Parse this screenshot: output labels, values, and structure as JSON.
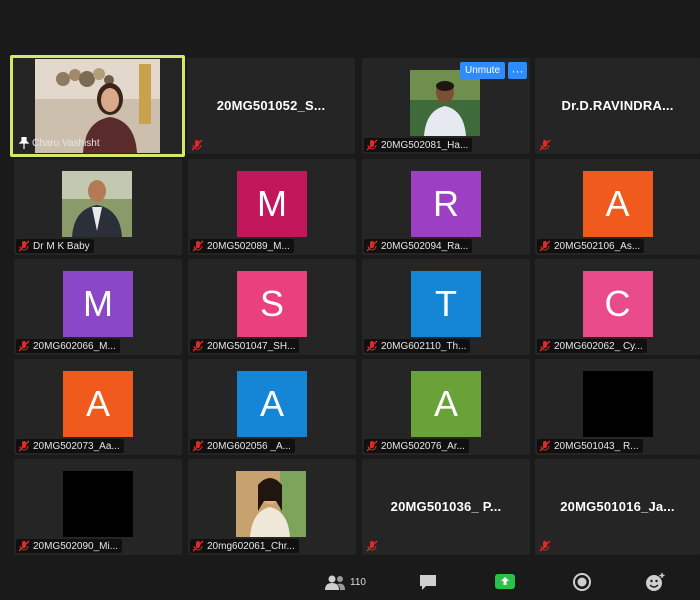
{
  "meeting": {
    "speaker": "Charu Vashisht",
    "participant_count": "110"
  },
  "controls": {
    "unmute_label": "Unmute",
    "more_label": "···"
  },
  "colors": {
    "speaker_border": "#d6e86a",
    "tile_bg": "#252525",
    "accent_blue": "#2d8cff",
    "mute_red": "#e02828",
    "share_green": "#27c24c"
  },
  "tiles": [
    {
      "label": "Charu Vashisht",
      "kind": "video",
      "speaker": true
    },
    {
      "label": "20MG501052_S...",
      "kind": "name"
    },
    {
      "label": "20MG502081_Ha...",
      "kind": "video"
    },
    {
      "label": "Dr.D.RAVINDRA...",
      "kind": "name"
    },
    {
      "label": "Dr M K Baby",
      "kind": "video"
    },
    {
      "label": "20MG502089_M...",
      "kind": "letter",
      "letter": "M",
      "color": "#c2185b"
    },
    {
      "label": "20MG502094_Ra...",
      "kind": "letter",
      "letter": "R",
      "color": "#9c3fc2"
    },
    {
      "label": "20MG502106_As...",
      "kind": "letter",
      "letter": "A",
      "color": "#f05a1c"
    },
    {
      "label": "20MG602066_M...",
      "kind": "letter",
      "letter": "M",
      "color": "#8a48c9"
    },
    {
      "label": "20MG501047_SH...",
      "kind": "letter",
      "letter": "S",
      "color": "#e8417b"
    },
    {
      "label": "20MG602110_Th...",
      "kind": "letter",
      "letter": "T",
      "color": "#1585d6"
    },
    {
      "label": "20MG602062_ Cy...",
      "kind": "letter",
      "letter": "C",
      "color": "#e84a8a"
    },
    {
      "label": "20MG502073_Aa...",
      "kind": "letter",
      "letter": "A",
      "color": "#f05a1c"
    },
    {
      "label": "20MG602056 _A...",
      "kind": "letter",
      "letter": "A",
      "color": "#1585d6"
    },
    {
      "label": "20MG502076_Ar...",
      "kind": "letter",
      "letter": "A",
      "color": "#6aa23a"
    },
    {
      "label": "20MG501043_ R...",
      "kind": "black"
    },
    {
      "label": "20MG502090_Mi...",
      "kind": "black"
    },
    {
      "label": "20mg602061_Chr...",
      "kind": "video"
    },
    {
      "label": "20MG501036_ P...",
      "kind": "name"
    },
    {
      "label": "20MG501016_Ja...",
      "kind": "name"
    }
  ]
}
